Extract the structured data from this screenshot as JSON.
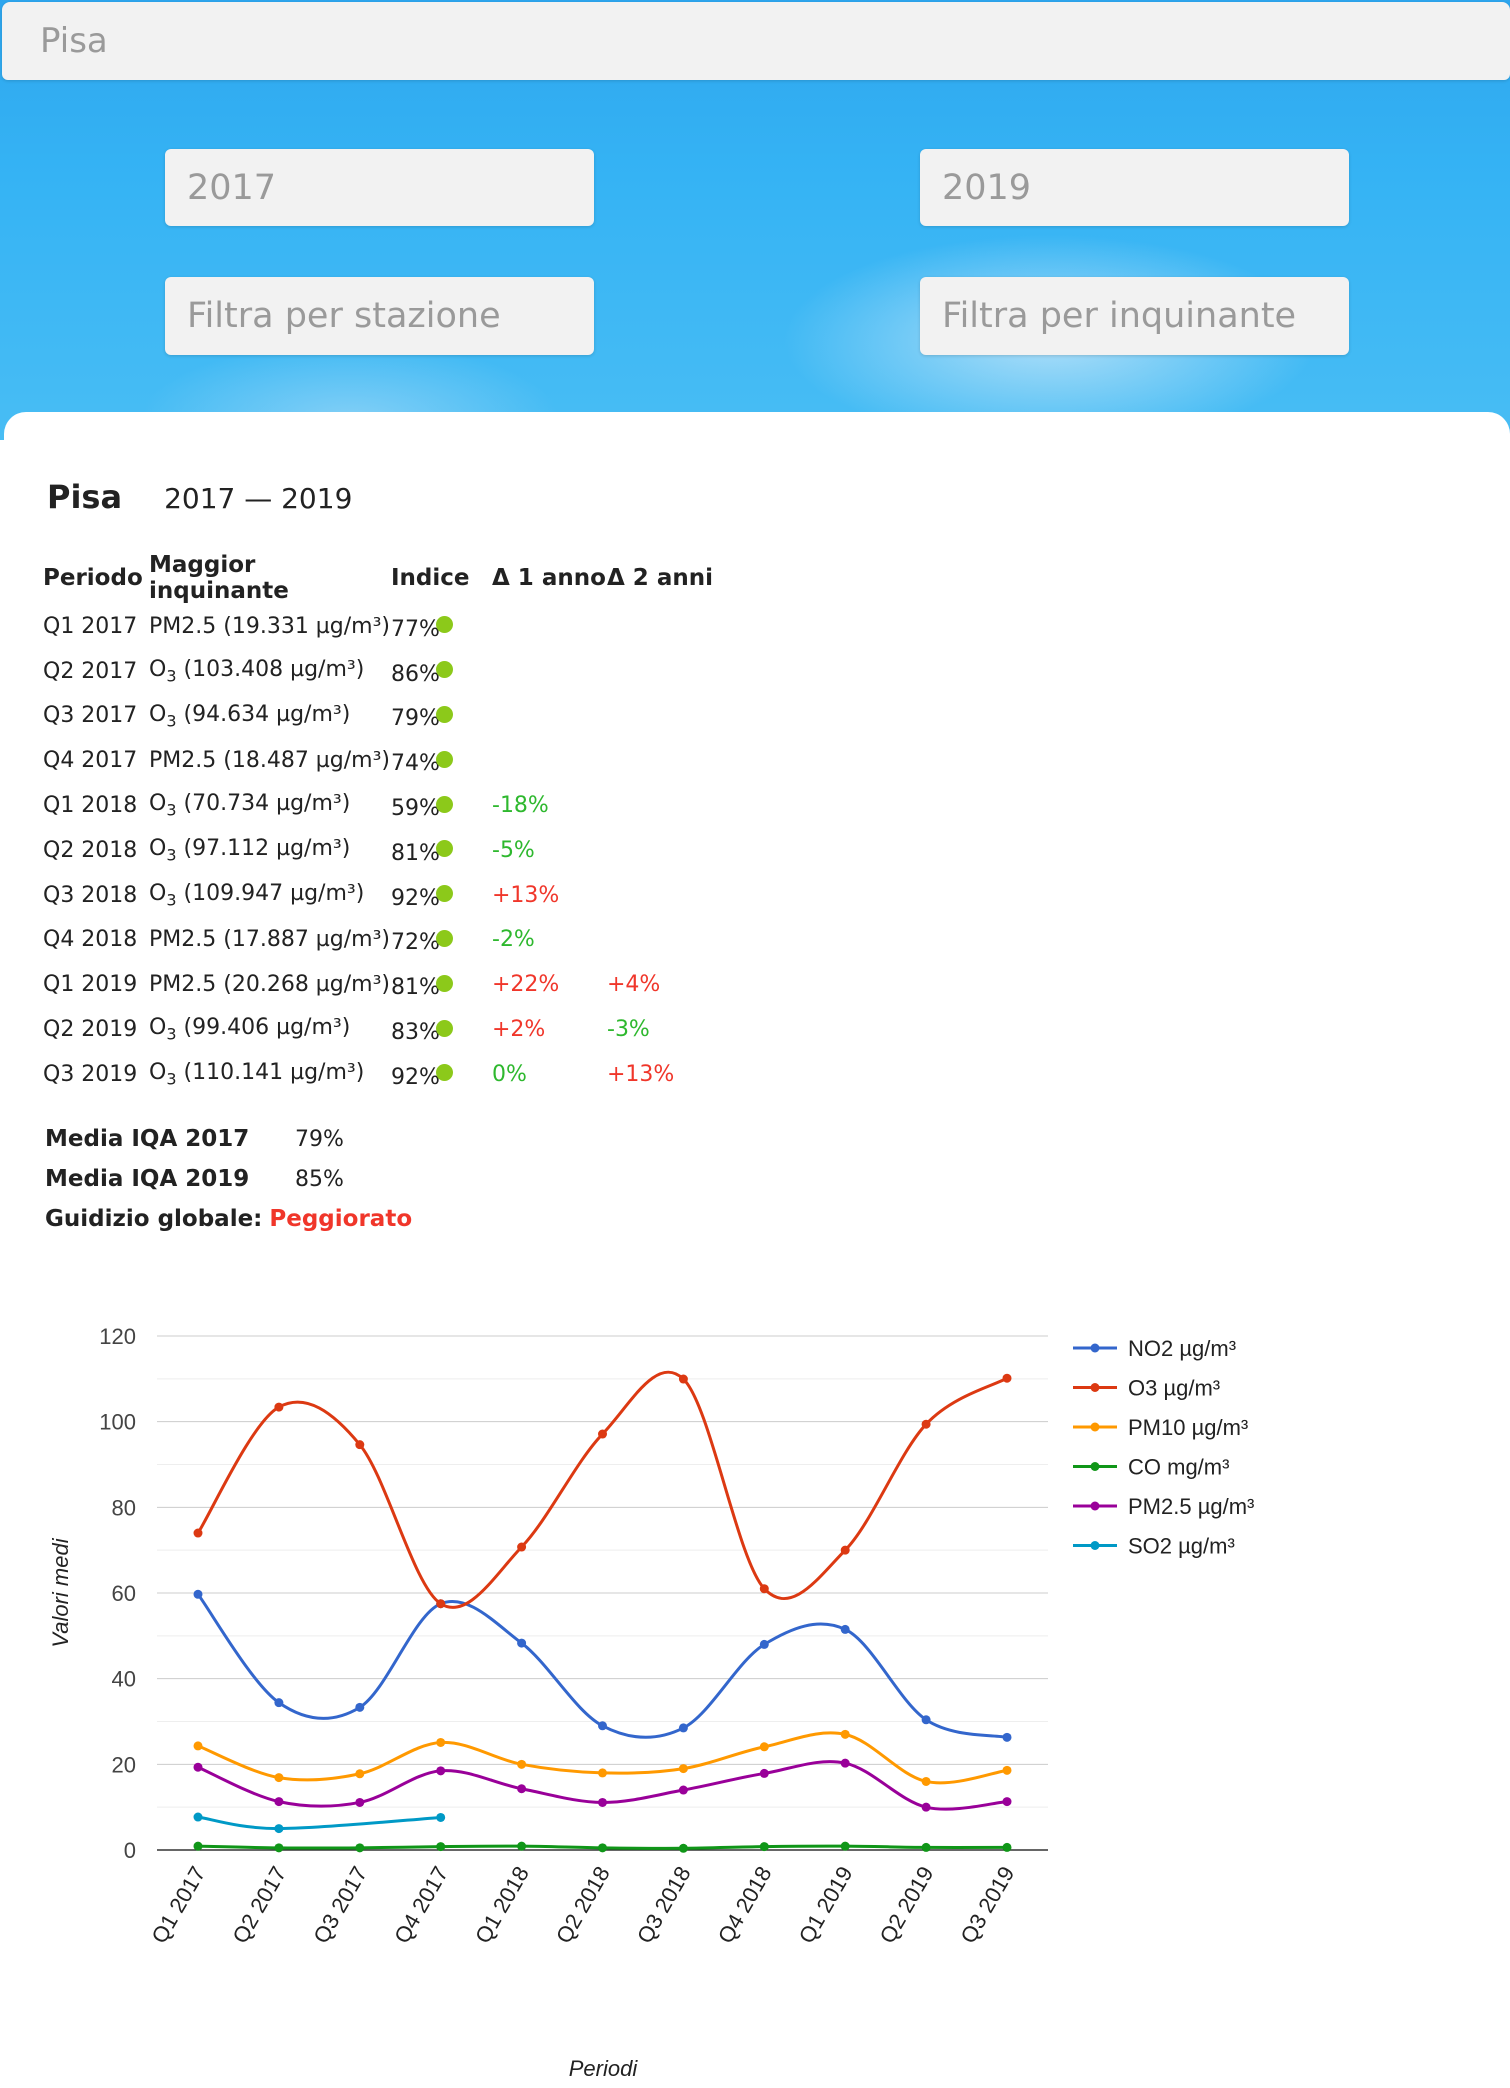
{
  "search": {
    "city_value": "Pisa"
  },
  "filters": {
    "year_from": "2017",
    "year_to": "2019",
    "station_placeholder": "Filtra per stazione",
    "pollutant_placeholder": "Filtra per inquinante"
  },
  "report": {
    "city": "Pisa",
    "range": "2017 — 2019",
    "headers": [
      "Periodo",
      "Maggior inquinante",
      "Indice",
      "Δ 1 anno",
      "Δ 2 anni"
    ],
    "rows": [
      {
        "period": "Q1 2017",
        "pollutant": "PM2.5",
        "value": "(19.331 µg/m³)",
        "index": "77%",
        "d1": "",
        "d2": ""
      },
      {
        "period": "Q2 2017",
        "pollutant": "O3",
        "value": "(103.408 µg/m³)",
        "index": "86%",
        "d1": "",
        "d2": ""
      },
      {
        "period": "Q3 2017",
        "pollutant": "O3",
        "value": "(94.634 µg/m³)",
        "index": "79%",
        "d1": "",
        "d2": ""
      },
      {
        "period": "Q4 2017",
        "pollutant": "PM2.5",
        "value": "(18.487 µg/m³)",
        "index": "74%",
        "d1": "",
        "d2": ""
      },
      {
        "period": "Q1 2018",
        "pollutant": "O3",
        "value": "(70.734 µg/m³)",
        "index": "59%",
        "d1": "-18%",
        "d2": ""
      },
      {
        "period": "Q2 2018",
        "pollutant": "O3",
        "value": "(97.112 µg/m³)",
        "index": "81%",
        "d1": "-5%",
        "d2": ""
      },
      {
        "period": "Q3 2018",
        "pollutant": "O3",
        "value": "(109.947 µg/m³)",
        "index": "92%",
        "d1": "+13%",
        "d2": ""
      },
      {
        "period": "Q4 2018",
        "pollutant": "PM2.5",
        "value": "(17.887 µg/m³)",
        "index": "72%",
        "d1": "-2%",
        "d2": ""
      },
      {
        "period": "Q1 2019",
        "pollutant": "PM2.5",
        "value": "(20.268 µg/m³)",
        "index": "81%",
        "d1": "+22%",
        "d2": "+4%"
      },
      {
        "period": "Q2 2019",
        "pollutant": "O3",
        "value": "(99.406 µg/m³)",
        "index": "83%",
        "d1": "+2%",
        "d2": "-3%"
      },
      {
        "period": "Q3 2019",
        "pollutant": "O3",
        "value": "(110.141 µg/m³)",
        "index": "92%",
        "d1": "0%",
        "d2": "+13%"
      }
    ],
    "summary": {
      "avg_label_1": "Media IQA 2017",
      "avg_value_1": "79%",
      "avg_label_2": "Media IQA 2019",
      "avg_value_2": "85%",
      "judgement_label": "Guidizio globale:",
      "judgement_value": "Peggiorato"
    },
    "colors": {
      "good_dot": "#8cc91a",
      "decrease": "#2eb82e",
      "increase": "#f0362a"
    }
  },
  "chart_data": {
    "type": "line",
    "xlabel": "Periodi",
    "ylabel": "Valori medi",
    "ylim": [
      0,
      120
    ],
    "yticks": [
      0,
      20,
      40,
      60,
      80,
      100,
      120
    ],
    "grid": true,
    "legend_position": "right",
    "categories": [
      "Q1 2017",
      "Q2 2017",
      "Q3 2017",
      "Q4 2017",
      "Q1 2018",
      "Q2 2018",
      "Q3 2018",
      "Q4 2018",
      "Q1 2019",
      "Q2 2019",
      "Q3 2019"
    ],
    "series": [
      {
        "name": "NO2 µg/m³",
        "color": "#3366cc",
        "values": [
          59.7,
          34.4,
          33.3,
          57.5,
          48.3,
          29.0,
          28.5,
          48.0,
          51.5,
          30.4,
          26.3
        ]
      },
      {
        "name": "O3 µg/m³",
        "color": "#dc3912",
        "values": [
          74.0,
          103.408,
          94.634,
          57.5,
          70.734,
          97.112,
          109.947,
          61.0,
          70.0,
          99.406,
          110.141
        ]
      },
      {
        "name": "PM10 µg/m³",
        "color": "#ff9900",
        "values": [
          24.3,
          16.9,
          17.8,
          25.1,
          20.0,
          18.0,
          19.0,
          24.1,
          27.0,
          16.0,
          18.6
        ]
      },
      {
        "name": "CO mg/m³",
        "color": "#109618",
        "values": [
          0.9,
          0.5,
          0.5,
          0.8,
          0.9,
          0.5,
          0.4,
          0.8,
          0.9,
          0.6,
          0.6
        ]
      },
      {
        "name": "PM2.5 µg/m³",
        "color": "#990099",
        "values": [
          19.331,
          11.3,
          11.1,
          18.487,
          14.3,
          11.1,
          14.0,
          17.887,
          20.268,
          10.0,
          11.3
        ]
      },
      {
        "name": "SO2 µg/m³",
        "color": "#0099c6",
        "values": [
          7.7,
          5.0,
          null,
          7.6,
          null,
          null,
          null,
          null,
          null,
          null,
          null
        ]
      }
    ]
  }
}
